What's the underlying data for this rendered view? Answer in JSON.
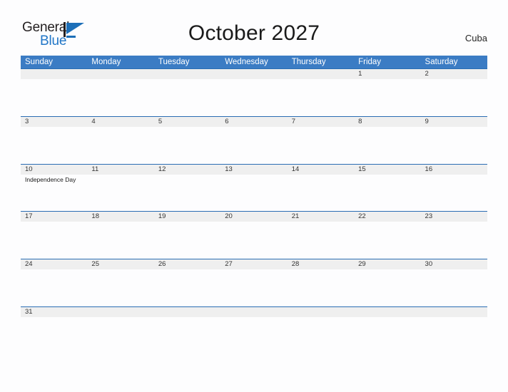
{
  "brand": {
    "name_part1": "General",
    "name_part2": "Blue",
    "primary_color": "#1d6fb8"
  },
  "header": {
    "title": "October 2027",
    "country": "Cuba"
  },
  "theme": {
    "header_blue": "#3b7cc4",
    "divider_blue": "#2a6db3",
    "band_gray": "#efefef",
    "page_background": "#fdfdfe"
  },
  "calendar": {
    "weekdays": [
      "Sunday",
      "Monday",
      "Tuesday",
      "Wednesday",
      "Thursday",
      "Friday",
      "Saturday"
    ],
    "weeks": [
      [
        {
          "day": "",
          "event": ""
        },
        {
          "day": "",
          "event": ""
        },
        {
          "day": "",
          "event": ""
        },
        {
          "day": "",
          "event": ""
        },
        {
          "day": "",
          "event": ""
        },
        {
          "day": "1",
          "event": ""
        },
        {
          "day": "2",
          "event": ""
        }
      ],
      [
        {
          "day": "3",
          "event": ""
        },
        {
          "day": "4",
          "event": ""
        },
        {
          "day": "5",
          "event": ""
        },
        {
          "day": "6",
          "event": ""
        },
        {
          "day": "7",
          "event": ""
        },
        {
          "day": "8",
          "event": ""
        },
        {
          "day": "9",
          "event": ""
        }
      ],
      [
        {
          "day": "10",
          "event": "Independence Day"
        },
        {
          "day": "11",
          "event": ""
        },
        {
          "day": "12",
          "event": ""
        },
        {
          "day": "13",
          "event": ""
        },
        {
          "day": "14",
          "event": ""
        },
        {
          "day": "15",
          "event": ""
        },
        {
          "day": "16",
          "event": ""
        }
      ],
      [
        {
          "day": "17",
          "event": ""
        },
        {
          "day": "18",
          "event": ""
        },
        {
          "day": "19",
          "event": ""
        },
        {
          "day": "20",
          "event": ""
        },
        {
          "day": "21",
          "event": ""
        },
        {
          "day": "22",
          "event": ""
        },
        {
          "day": "23",
          "event": ""
        }
      ],
      [
        {
          "day": "24",
          "event": ""
        },
        {
          "day": "25",
          "event": ""
        },
        {
          "day": "26",
          "event": ""
        },
        {
          "day": "27",
          "event": ""
        },
        {
          "day": "28",
          "event": ""
        },
        {
          "day": "29",
          "event": ""
        },
        {
          "day": "30",
          "event": ""
        }
      ],
      [
        {
          "day": "31",
          "event": ""
        },
        {
          "day": "",
          "event": ""
        },
        {
          "day": "",
          "event": ""
        },
        {
          "day": "",
          "event": ""
        },
        {
          "day": "",
          "event": ""
        },
        {
          "day": "",
          "event": ""
        },
        {
          "day": "",
          "event": ""
        }
      ]
    ]
  }
}
